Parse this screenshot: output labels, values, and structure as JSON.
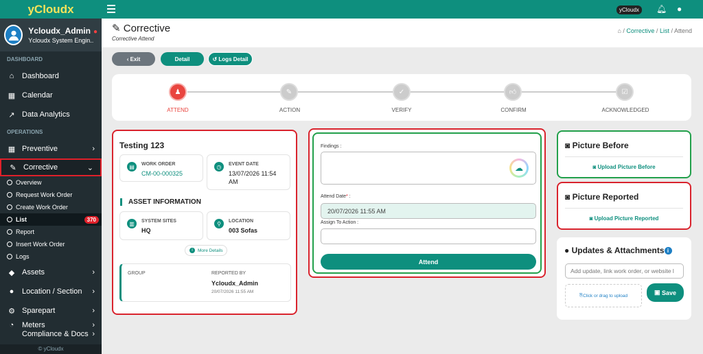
{
  "app": {
    "brand": "yCloudx",
    "footer": "© yCloudx"
  },
  "user": {
    "name": "Ycloudx_Admin",
    "status": "●",
    "role": "Ycloudx System Engin..."
  },
  "sidebar": {
    "section_dashboard": "DASHBOARD",
    "dashboard": [
      {
        "label": "Dashboard",
        "icon": "home-icon"
      },
      {
        "label": "Calendar",
        "icon": "calendar-icon"
      },
      {
        "label": "Data Analytics",
        "icon": "chart-icon"
      }
    ],
    "section_operations": "OPERATIONS",
    "preventive": "Preventive",
    "corrective": "Corrective",
    "corrective_sub": [
      "Overview",
      "Request Work Order",
      "Create Work Order",
      "List",
      "Report",
      "Insert Work Order",
      "Logs"
    ],
    "list_badge": "370",
    "more": [
      "Assets",
      "Location / Section",
      "Sparepart",
      "Meters",
      "Compliance & Docs"
    ]
  },
  "topbar": {
    "tag": "yCloudx"
  },
  "header": {
    "title": "Corrective",
    "subtitle": "Corrective Attend",
    "breadcrumb": [
      "Corrective",
      "List",
      "Attend"
    ]
  },
  "actions": {
    "exit": "Exit",
    "detail": "Detail",
    "logs": "Logs Detail"
  },
  "steps": [
    "ATTEND",
    "ACTION",
    "VERIFY",
    "CONFIRM",
    "ACKNOWLEDGED"
  ],
  "work": {
    "title": "Testing 123",
    "wo_label": "WORK ORDER",
    "wo_value": "CM-00-000325",
    "event_label": "EVENT DATE",
    "event_value_1": "13/07/2026 11:54",
    "event_value_2": "AM",
    "asset_heading": "ASSET INFORMATION",
    "system_label": "SYSTEM SITES",
    "system_value": "HQ",
    "location_label": "LOCATION",
    "location_value": "003 Sofas",
    "more_details": "More Details",
    "group_label": "GROUP",
    "reported_label": "REPORTED BY",
    "reported_value": "Ycloudx_Admin",
    "reported_date": "20/07/2026 11:55 AM"
  },
  "form": {
    "findings_label": "Findings :",
    "attend_date_label": "Attend Date",
    "attend_date_req": "*",
    "attend_date_colon": " :",
    "attend_date_value": "20/07/2026 11:55 AM",
    "assign_label": "Assign To Action :",
    "assign_value": "",
    "attend_button": "Attend"
  },
  "pictures": {
    "before_title": "Picture Before",
    "before_upload": "Upload Picture Before",
    "reported_title": "Picture Reported",
    "reported_upload": "Upload Picture Reported"
  },
  "updates": {
    "title": "Updates & Attachments",
    "placeholder": "Add update, link work order, or website l",
    "drop": "Click or drag to upload",
    "save": "Save"
  },
  "colors": {
    "brand": "#0e8f7e",
    "active_step": "#e9453f",
    "highlight": "#d9232d",
    "success": "#22a04b"
  }
}
